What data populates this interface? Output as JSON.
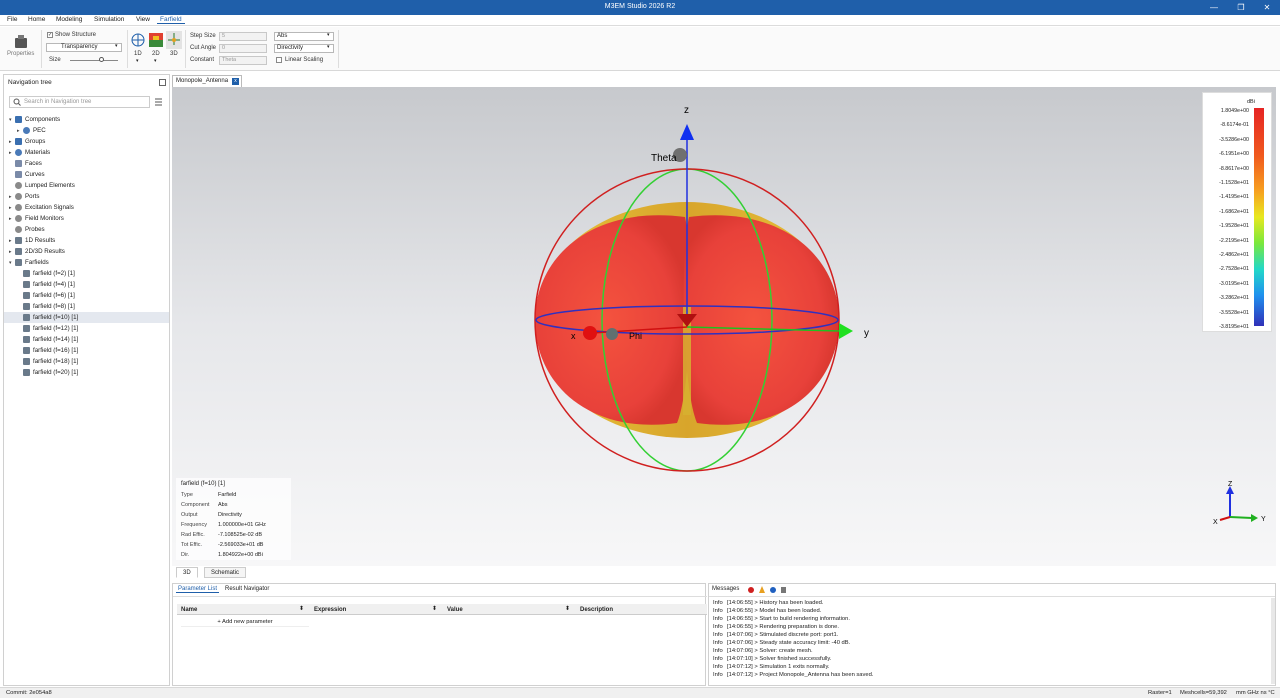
{
  "window": {
    "title": "M3EM Studio 2026 R2",
    "minimize": "—",
    "maximize": "❐",
    "close": "✕"
  },
  "menu": {
    "items": [
      "File",
      "Home",
      "Modeling",
      "Simulation",
      "View",
      "Farfield"
    ],
    "active": "Farfield"
  },
  "ribbon": {
    "properties_label": "Properties",
    "show_structure": "Show Structure",
    "transparency": "Transparency",
    "size_label": "Size",
    "dim_buttons": [
      "1D",
      "2D",
      "3D"
    ],
    "step_size_label": "Step Size",
    "step_size_value": "5",
    "cut_angle_label": "Cut Angle",
    "cut_angle_value": "0",
    "constant_label": "Constant",
    "constant_value": "Theta",
    "abs_select": "Abs",
    "directivity_select": "Directivity",
    "linear_scaling": "Linear Scaling"
  },
  "nav": {
    "title": "Navigation tree",
    "search_placeholder": "Search in Navigation tree",
    "items": [
      {
        "label": "Components",
        "arrow": "▾",
        "indent": 0,
        "icon": "components"
      },
      {
        "label": "PEC",
        "arrow": "▸",
        "indent": 1,
        "icon": "material"
      },
      {
        "label": "Groups",
        "arrow": "▸",
        "indent": 0,
        "icon": "components"
      },
      {
        "label": "Materials",
        "arrow": "▸",
        "indent": 0,
        "icon": "material"
      },
      {
        "label": "Faces",
        "arrow": "",
        "indent": 0,
        "icon": "face"
      },
      {
        "label": "Curves",
        "arrow": "",
        "indent": 0,
        "icon": "face"
      },
      {
        "label": "Lumped Elements",
        "arrow": "",
        "indent": 0,
        "icon": "gear"
      },
      {
        "label": "Ports",
        "arrow": "▸",
        "indent": 0,
        "icon": "gear"
      },
      {
        "label": "Excitation Signals",
        "arrow": "▸",
        "indent": 0,
        "icon": "gear"
      },
      {
        "label": "Field Monitors",
        "arrow": "▸",
        "indent": 0,
        "icon": "gear"
      },
      {
        "label": "Probes",
        "arrow": "",
        "indent": 0,
        "icon": "gear"
      },
      {
        "label": "1D Results",
        "arrow": "▸",
        "indent": 0,
        "icon": "chart"
      },
      {
        "label": "2D/3D Results",
        "arrow": "▸",
        "indent": 0,
        "icon": "chart"
      },
      {
        "label": "Farfields",
        "arrow": "▾",
        "indent": 0,
        "icon": "chart"
      },
      {
        "label": "farfield (f=2) [1]",
        "arrow": "",
        "indent": 1,
        "icon": "chart"
      },
      {
        "label": "farfield (f=4) [1]",
        "arrow": "",
        "indent": 1,
        "icon": "chart"
      },
      {
        "label": "farfield (f=6) [1]",
        "arrow": "",
        "indent": 1,
        "icon": "chart"
      },
      {
        "label": "farfield (f=8) [1]",
        "arrow": "",
        "indent": 1,
        "icon": "chart"
      },
      {
        "label": "farfield (f=10) [1]",
        "arrow": "",
        "indent": 1,
        "icon": "chart",
        "selected": true
      },
      {
        "label": "farfield (f=12) [1]",
        "arrow": "",
        "indent": 1,
        "icon": "chart"
      },
      {
        "label": "farfield (f=14) [1]",
        "arrow": "",
        "indent": 1,
        "icon": "chart"
      },
      {
        "label": "farfield (f=16) [1]",
        "arrow": "",
        "indent": 1,
        "icon": "chart"
      },
      {
        "label": "farfield (f=18) [1]",
        "arrow": "",
        "indent": 1,
        "icon": "chart"
      },
      {
        "label": "farfield (f=20) [1]",
        "arrow": "",
        "indent": 1,
        "icon": "chart"
      }
    ]
  },
  "doc_tab": {
    "label": "Monopole_Antenna",
    "close": "x"
  },
  "viewport": {
    "axis_z": "z",
    "axis_y": "y",
    "axis_x": "x",
    "theta_label": "Theta",
    "phi_label": "Phi",
    "triad_z": "Z",
    "triad_y": "Y",
    "triad_x": "X"
  },
  "legend": {
    "unit": "dBi",
    "values": [
      "1.8049e+00",
      "-8.6174e-01",
      "-3.5286e+00",
      "-6.1951e+00",
      "-8.8617e+00",
      "-1.1528e+01",
      "-1.4195e+01",
      "-1.6862e+01",
      "-1.9528e+01",
      "-2.2195e+01",
      "-2.4862e+01",
      "-2.7528e+01",
      "-3.0195e+01",
      "-3.2862e+01",
      "-3.5528e+01",
      "-3.8195e+01"
    ]
  },
  "info": {
    "title": "farfield (f=10) [1]",
    "rows": [
      {
        "key": "Type",
        "value": "Farfield"
      },
      {
        "key": "Component",
        "value": "Abs"
      },
      {
        "key": "Output",
        "value": "Directivity"
      },
      {
        "key": "Frequency",
        "value": "1.000000e+01 GHz"
      },
      {
        "key": "Rad Effic.",
        "value": "-7.108525e-02 dB"
      },
      {
        "key": "Tot Effic.",
        "value": "-2.569033e+01 dB"
      },
      {
        "key": "Dir.",
        "value": "1.804922e+00 dBi"
      }
    ]
  },
  "view_tabs": [
    "3D",
    "Schematic"
  ],
  "params": {
    "tabs": [
      "Parameter List",
      "Result Navigator"
    ],
    "columns": [
      "Name",
      "Expression",
      "Value",
      "Description"
    ],
    "add_new": "+ Add new parameter"
  },
  "messages": {
    "title": "Messages",
    "lines": [
      {
        "level": "Info",
        "text": "[14:06:55] > History has been loaded."
      },
      {
        "level": "Info",
        "text": "[14:06:55] > Model has been loaded."
      },
      {
        "level": "Info",
        "text": "[14:06:55] > Start to build rendering information."
      },
      {
        "level": "Info",
        "text": "[14:06:55] > Rendering preparation is done."
      },
      {
        "level": "Info",
        "text": "[14:07:06] > Stimulated discrete port: port1."
      },
      {
        "level": "Info",
        "text": "[14:07:06] > Steady state accuracy limit: -40 dB."
      },
      {
        "level": "Info",
        "text": "[14:07:06] > Solver: create mesh."
      },
      {
        "level": "Info",
        "text": "[14:07:10] > Solver finished successfully."
      },
      {
        "level": "Info",
        "text": "[14:07:12] > Simulation 1 exits normally."
      },
      {
        "level": "Info",
        "text": "[14:07:12] > Project Monopole_Antenna has been saved."
      }
    ]
  },
  "status": {
    "commit": "Commit: 2e054a8",
    "raster": "Raster=1",
    "meshcells": "Meshcells=59,392",
    "units": "mm GHz ns °C"
  },
  "colors": {
    "accent": "#1f5faa",
    "pattern_red": "#e8413a",
    "pattern_yellow": "#e2b93a"
  }
}
